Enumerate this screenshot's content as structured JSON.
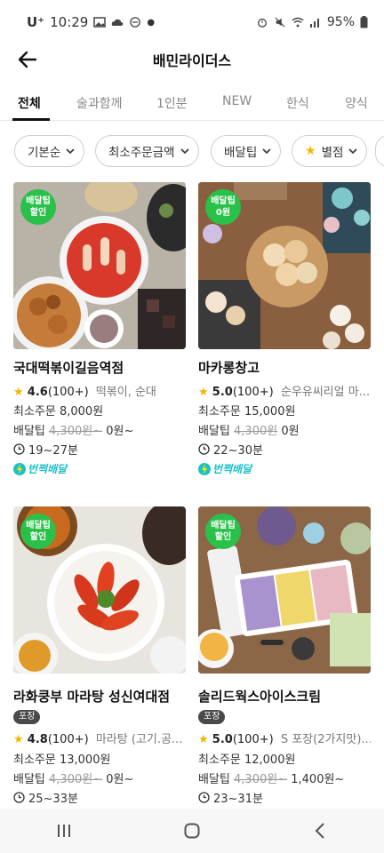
{
  "status_bar": {
    "carrier": "U⁺",
    "time": "10:29",
    "battery": "95%"
  },
  "header": {
    "title": "배민라이더스"
  },
  "tabs": [
    "전체",
    "술과함께",
    "1인분",
    "NEW",
    "한식",
    "양식"
  ],
  "filters": [
    {
      "label": "기본순"
    },
    {
      "label": "최소주문금액"
    },
    {
      "label": "배달팁"
    },
    {
      "label": "별점",
      "star": "★"
    }
  ],
  "restaurants": [
    {
      "name": "국대떡볶이길음역점",
      "badge_line1": "배달팁",
      "badge_line2": "할인",
      "rating": "4.6",
      "review_count": "(100+)",
      "menu": "떡볶이, 순대",
      "min_order": "최소주문 8,000원",
      "tip_label": "배달팁",
      "tip_old": "4,300원~",
      "tip_new": "0원~",
      "time": "19~27분",
      "lightning": "번쩍배달"
    },
    {
      "name": "마카롱창고",
      "badge_line1": "배달팁",
      "badge_line2": "0원",
      "rating": "5.0",
      "review_count": "(100+)",
      "menu": "순우유씨리얼 마...",
      "min_order": "최소주문 15,000원",
      "tip_label": "배달팁",
      "tip_old": "4,300원",
      "tip_new": "0원",
      "time": "22~30분",
      "lightning": "번쩍배달"
    },
    {
      "name": "라화쿵부 마라탕 성신여대점",
      "badge_line1": "배달팁",
      "badge_line2": "할인",
      "tag": "포장",
      "rating": "4.8",
      "review_count": "(100+)",
      "menu": "마라탕 (고기.공...",
      "min_order": "최소주문 13,000원",
      "tip_label": "배달팁",
      "tip_old": "4,300원~",
      "tip_new": "0원~",
      "time": "25~33분"
    },
    {
      "name": "솔리드웍스아이스크림",
      "badge_line1": "배달팁",
      "badge_line2": "할인",
      "tag": "포장",
      "rating": "5.0",
      "review_count": "(100+)",
      "menu": "S 포장(2가지맛)...",
      "min_order": "최소주문 12,000원",
      "tip_label": "배달팁",
      "tip_old": "4,300원~",
      "tip_new": "1,400원~",
      "time": "23~31분"
    }
  ],
  "colors": {
    "badge_green": "#2ac14a",
    "star": "#f5b400",
    "lightning": "#1ec0c8"
  }
}
